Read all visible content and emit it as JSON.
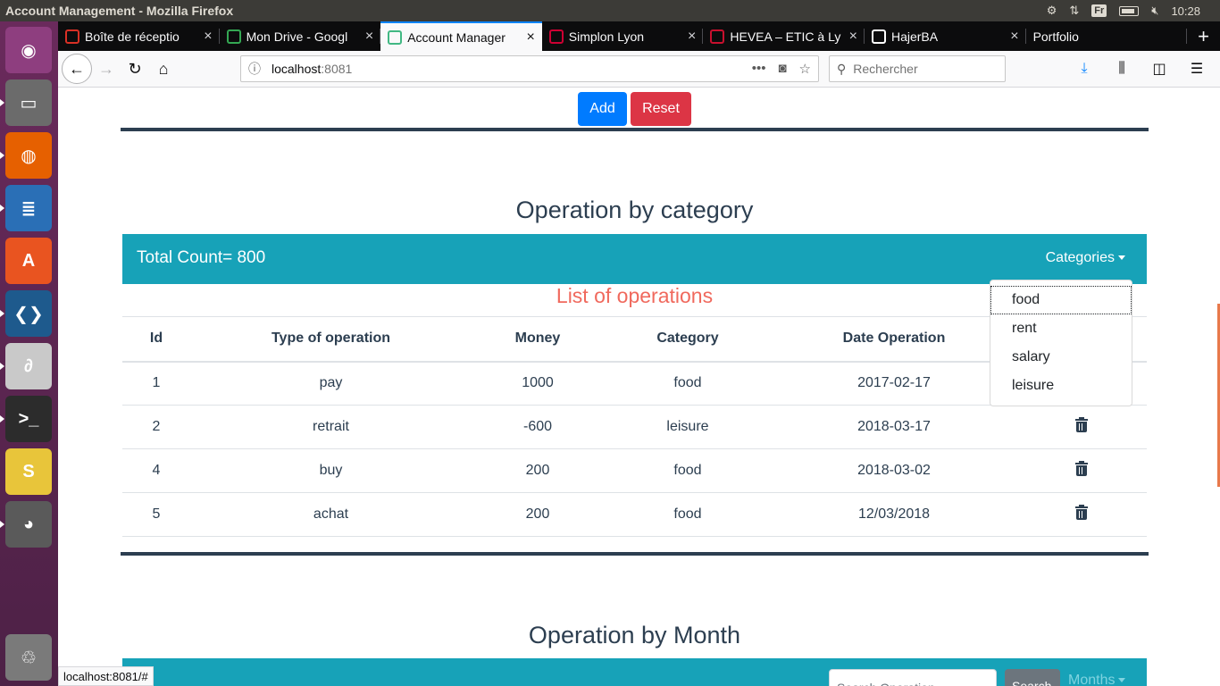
{
  "system": {
    "window_title": "Account Management - Mozilla Firefox",
    "keyboard_layout": "Fr",
    "time": "10:28"
  },
  "launcher": [
    {
      "name": "ubuntu-dash-icon",
      "color": "#8e3e7f"
    },
    {
      "name": "files-icon",
      "color": "#6b6b6b"
    },
    {
      "name": "firefox-icon",
      "color": "#e66000"
    },
    {
      "name": "libreoffice-writer-icon",
      "color": "#2a6fb6"
    },
    {
      "name": "software-center-icon",
      "color": "#e95420"
    },
    {
      "name": "vscode-icon",
      "color": "#1e5a8d"
    },
    {
      "name": "pdf-reader-icon",
      "color": "#c9c9c9"
    },
    {
      "name": "terminal-icon",
      "color": "#2c2c2c"
    },
    {
      "name": "slack-icon",
      "color": "#e8c53a"
    },
    {
      "name": "gimp-icon",
      "color": "#5a5a5a"
    },
    {
      "name": "trash-icon",
      "color": "#7a7a7a"
    }
  ],
  "tabs": [
    {
      "label": "Boîte de réceptio",
      "icon": "gmail-icon",
      "icon_color": "#d93025"
    },
    {
      "label": "Mon Drive - Googl",
      "icon": "google-drive-icon",
      "icon_color": "#34a853"
    },
    {
      "label": "Account Manager",
      "icon": "vue-icon",
      "icon_color": "#41b883",
      "active": true
    },
    {
      "label": "Simplon Lyon",
      "icon": "simplon-icon",
      "icon_color": "#ce0033"
    },
    {
      "label": "HEVEA – ETIC à Ly",
      "icon": "hevea-icon",
      "icon_color": "#c8102e"
    },
    {
      "label": "HajerBA",
      "icon": "github-icon",
      "icon_color": "#ffffff"
    },
    {
      "label": "Portfolio",
      "icon": "",
      "icon_color": ""
    }
  ],
  "nav": {
    "url_host": "localhost",
    "url_port": ":8081",
    "search_placeholder": "Rechercher"
  },
  "form": {
    "add_label": "Add",
    "reset_label": "Reset"
  },
  "category_section": {
    "title": "Operation by category",
    "total_count": "Total Count= 800",
    "categories_label": "Categories",
    "list_title": "List of operations",
    "columns": [
      "Id",
      "Type of operation",
      "Money",
      "Category",
      "Date Operation",
      ""
    ],
    "rows": [
      {
        "id": "1",
        "type": "pay",
        "money": "1000",
        "category": "food",
        "date": "2017-02-17"
      },
      {
        "id": "2",
        "type": "retrait",
        "money": "-600",
        "category": "leisure",
        "date": "2018-03-17"
      },
      {
        "id": "4",
        "type": "buy",
        "money": "200",
        "category": "food",
        "date": "2018-03-02"
      },
      {
        "id": "5",
        "type": "achat",
        "money": "200",
        "category": "food",
        "date": "12/03/2018"
      }
    ],
    "dropdown_items": [
      "food",
      "rent",
      "salary",
      "leisure"
    ]
  },
  "month_section": {
    "title": "Operation by Month",
    "search_placeholder": "Search Operation",
    "search_button": "Search",
    "months_label": "Months"
  },
  "status_url": "localhost:8081/#",
  "colors": {
    "primary": "#007bff",
    "danger": "#dc3545",
    "info": "#17a2b8",
    "dark": "#2c3e50",
    "list_title": "#f0695d"
  }
}
